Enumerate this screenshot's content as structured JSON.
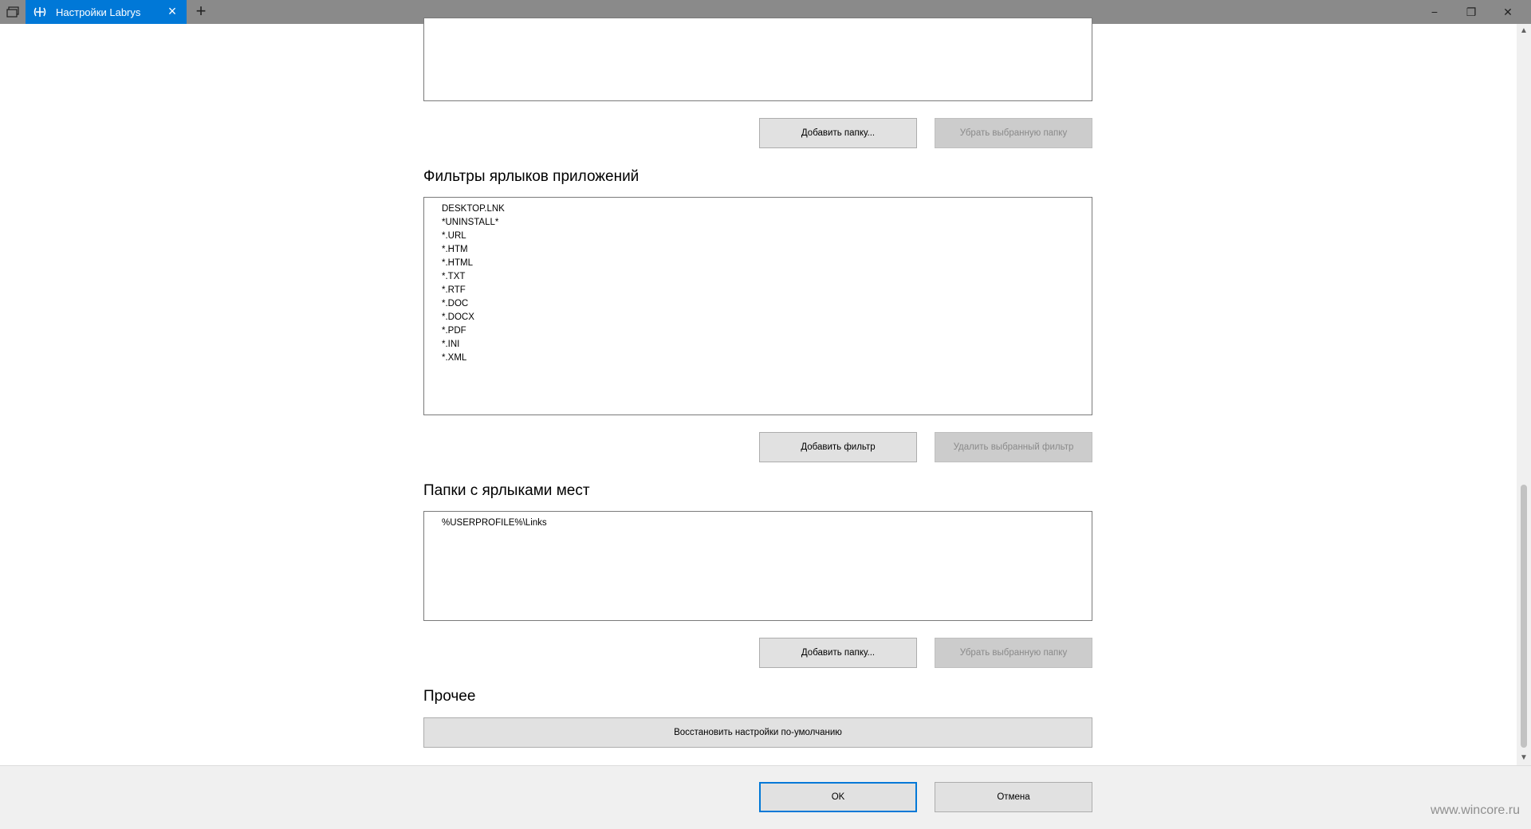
{
  "window": {
    "tab_title": "Настройки Labrys",
    "close_tab_icon": "×",
    "new_tab_icon": "+",
    "minimize_icon": "−",
    "restore_icon": "❐",
    "close_icon": "✕"
  },
  "sections": {
    "folders_top": {
      "add_button": "Добавить папку...",
      "remove_button": "Убрать выбранную папку"
    },
    "app_filters": {
      "title": "Фильтры ярлыков приложений",
      "items": [
        "DESKTOP.LNK",
        "*UNINSTALL*",
        "*.URL",
        "*.HTM",
        "*.HTML",
        "*.TXT",
        "*.RTF",
        "*.DOC",
        "*.DOCX",
        "*.PDF",
        "*.INI",
        "*.XML"
      ],
      "add_button": "Добавить фильтр",
      "remove_button": "Удалить выбранный фильтр"
    },
    "places_folders": {
      "title": "Папки с ярлыками мест",
      "items": [
        "%USERPROFILE%\\Links"
      ],
      "add_button": "Добавить папку...",
      "remove_button": "Убрать выбранную папку"
    },
    "other": {
      "title": "Прочее",
      "reset_button": "Восстановить настройки по-умолчанию"
    }
  },
  "footer": {
    "ok_button": "OK",
    "cancel_button": "Отмена"
  },
  "watermark": "www.wincore.ru",
  "colors": {
    "titlebar": "#8a8a8a",
    "tab_accent": "#0078d7",
    "button": "#e1e1e1",
    "button_disabled": "#cccccc"
  }
}
